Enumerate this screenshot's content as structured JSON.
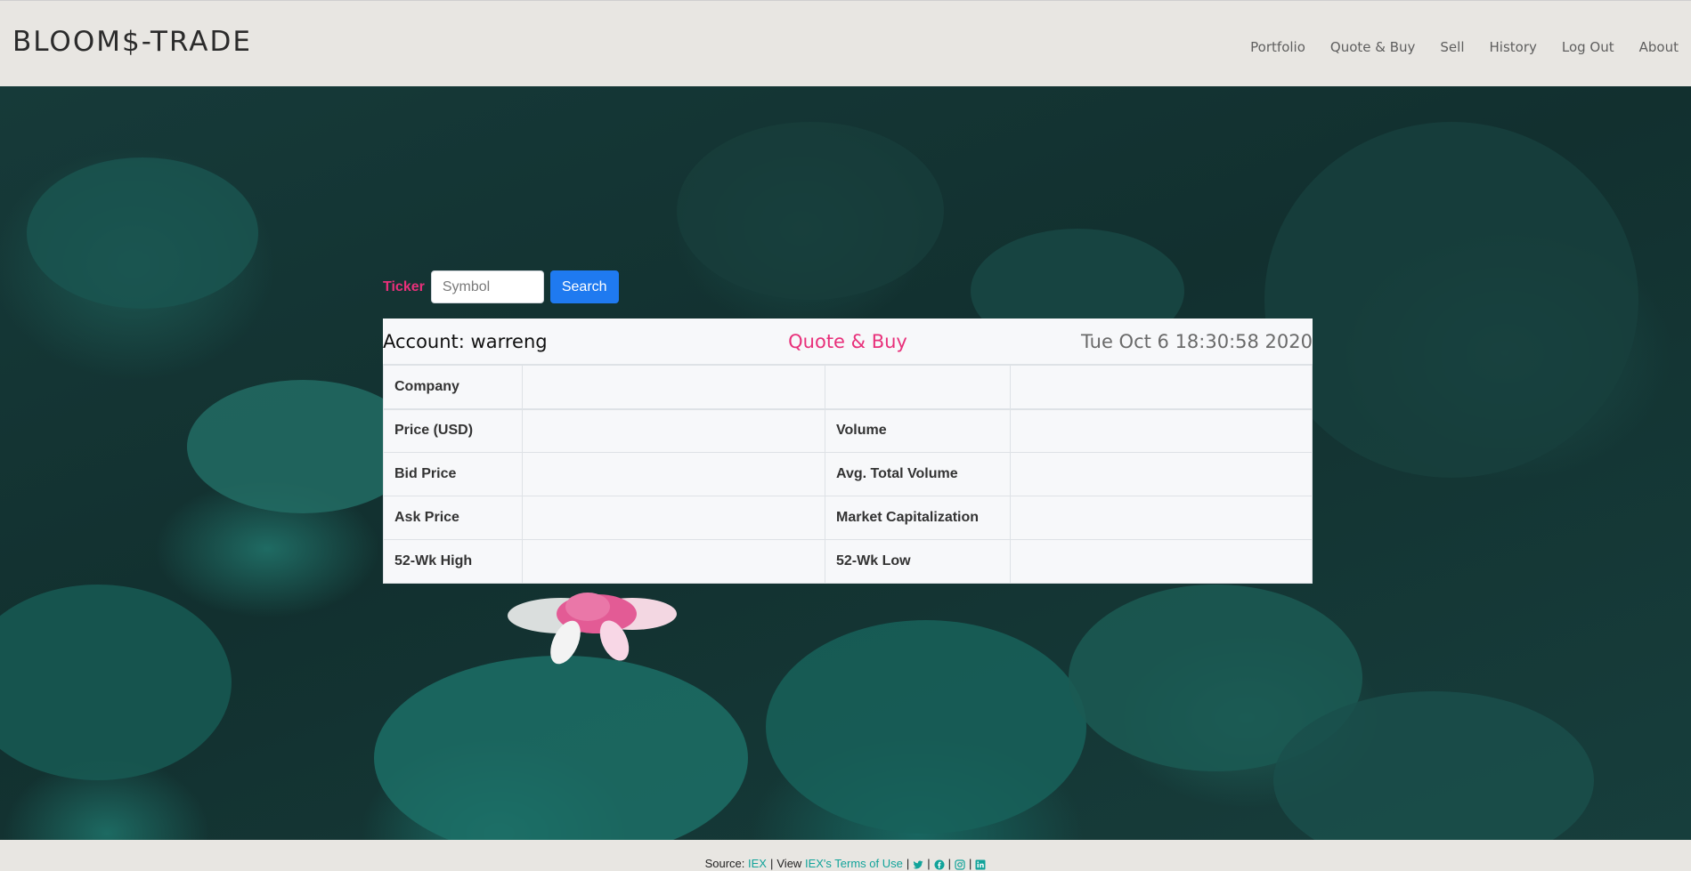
{
  "brand": "BLOOM$-TRADE",
  "nav": [
    {
      "label": "Portfolio"
    },
    {
      "label": "Quote & Buy"
    },
    {
      "label": "Sell"
    },
    {
      "label": "History"
    },
    {
      "label": "Log Out"
    },
    {
      "label": "About"
    }
  ],
  "search": {
    "label": "Ticker",
    "placeholder": "Symbol",
    "value": "",
    "button": "Search"
  },
  "panel": {
    "account": "Account: warreng",
    "title": "Quote & Buy",
    "datetime": "Tue Oct 6 18:30:58 2020"
  },
  "table": {
    "rows": [
      {
        "left_label": "Company",
        "left_value": "",
        "right_label": "",
        "right_value": ""
      },
      {
        "left_label": "Price (USD)",
        "left_value": "",
        "right_label": "Volume",
        "right_value": ""
      },
      {
        "left_label": "Bid Price",
        "left_value": "",
        "right_label": "Avg. Total Volume",
        "right_value": ""
      },
      {
        "left_label": "Ask Price",
        "left_value": "",
        "right_label": "Market Capitalization",
        "right_value": ""
      },
      {
        "left_label": "52-Wk High",
        "left_value": "",
        "right_label": "52-Wk Low",
        "right_value": ""
      }
    ]
  },
  "footer": {
    "source_prefix": "Source:",
    "source_link": "IEX",
    "view_prefix": "View",
    "terms_link": "IEX's Terms of Use",
    "icons": [
      "twitter-icon",
      "facebook-icon",
      "instagram-icon",
      "linkedin-icon"
    ]
  },
  "colors": {
    "accent_pink": "#e8307a",
    "button_blue": "#1f7af0",
    "link_teal": "#11a39a"
  }
}
